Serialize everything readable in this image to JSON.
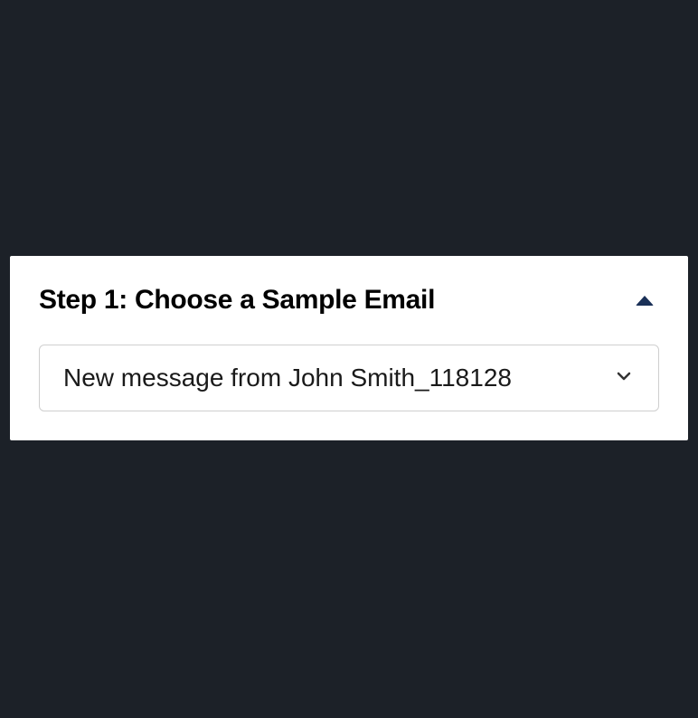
{
  "step": {
    "title": "Step 1: Choose a Sample Email",
    "select": {
      "selected": "New message from John Smith_118128"
    }
  }
}
